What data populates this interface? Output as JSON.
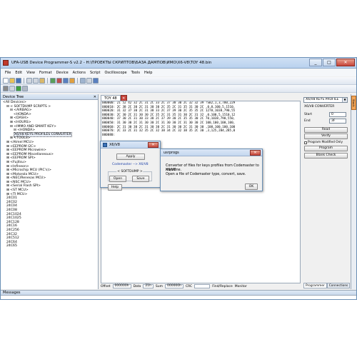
{
  "window": {
    "title": "UFA-USB Device Programmer-S v2.2 - H:\\ПРОЕКТЫ СКРИПТОВ\\БАЗА ДАМПОВ\\ИМО\\X6-V8\\TOY 48.bin",
    "minimize": "_",
    "maximize": "□",
    "close": "✕"
  },
  "menu": [
    "File",
    "Edit",
    "View",
    "Format",
    "Device",
    "Actions",
    "Script",
    "Oscilloscope",
    "Tools",
    "Help"
  ],
  "tree": {
    "header": "Device Tree",
    "close": "✕",
    "items": [
      {
        "text": "<All Devices>",
        "indent": 0
      },
      {
        "text": "⊟ < SOFTDUMP SCRIPTS >",
        "indent": 1
      },
      {
        "text": "⊟ <AIRBAG>",
        "indent": 2
      },
      {
        "text": "<HONDA>",
        "indent": 3
      },
      {
        "text": "⊞ <DASH>",
        "indent": 2
      },
      {
        "text": "⊞ <HOURS>",
        "indent": 2
      },
      {
        "text": "⊟ <IMMO AND SMART KEY>",
        "indent": 2
      },
      {
        "text": "⊟ <HONDA>",
        "indent": 3
      },
      {
        "text": "X6/V8 KEYS PROFILES CONVERTER",
        "indent": 3,
        "selected": true
      },
      {
        "text": "⊞ <TOOLS>",
        "indent": 2
      },
      {
        "text": "⊞ <Atmel MCU>",
        "indent": 1
      },
      {
        "text": "⊞ <EEPROM I2C>",
        "indent": 1
      },
      {
        "text": "⊞ <EEPROM Microwire>",
        "indent": 1
      },
      {
        "text": "⊞ <EEPROM Miscellaneous>",
        "indent": 1
      },
      {
        "text": "⊞ <EEPROM SPI>",
        "indent": 1
      },
      {
        "text": "⊞ <Fujitsu>",
        "indent": 1
      },
      {
        "text": "⊞ <Infineon>",
        "indent": 1
      },
      {
        "text": "⊞ <Microchip MCU (PIC's)>",
        "indent": 1
      },
      {
        "text": "⊞ <Motorola MCU>",
        "indent": 1
      },
      {
        "text": "⊞ <NEC/Renesas MCU>",
        "indent": 1
      },
      {
        "text": "⊞ <NSC MCU>",
        "indent": 1
      },
      {
        "text": "⊞ <Serial Flash SPI>",
        "indent": 1
      },
      {
        "text": "⊞ <ST MCU>",
        "indent": 1
      },
      {
        "text": "⊞ <TI MCU>",
        "indent": 1
      },
      {
        "text": "24C01",
        "indent": 1
      },
      {
        "text": "24C02",
        "indent": 1
      },
      {
        "text": "24C04",
        "indent": 1
      },
      {
        "text": "24C08",
        "indent": 1
      },
      {
        "text": "24C1024",
        "indent": 1
      },
      {
        "text": "24C1025",
        "indent": 1
      },
      {
        "text": "24C128",
        "indent": 1
      },
      {
        "text": "24C16",
        "indent": 1
      },
      {
        "text": "24C256",
        "indent": 1
      },
      {
        "text": "24C32",
        "indent": 1
      },
      {
        "text": "24C512",
        "indent": 1
      },
      {
        "text": "24C64",
        "indent": 1
      },
      {
        "text": "24C65",
        "indent": 1
      }
    ]
  },
  "doc_tab": "TOY 48",
  "doc_tab_close": "✕",
  "hex_rows": [
    "000000:  21 52 42 32 2C 31 2C 33 2C 37 38 30 2C 32 32 39  !SB2,1,3,780,229",
    "000010:  2C 38 2C 30 2C 31 30 30 2C 35 2C 31 35 31 30 2C  ,0,0,100,5,1510,",
    "000020:  31 32 37 30 2C 31 38 33 2C 37 39 30 2C 35 35 2C  1270,1038,790,55",
    "000030:  2C 30 2C 31 30 30 2C 35 2C 31 35 31 30 2C 31 32  ,0,100,5,1510,12",
    "000040:  37 30 2C 31 30 33 38 2C 37 39 30 2C 35 35 30 2C  70,1038,790,550,",
    "000050:  31 30 30 2C 31 30 30 2C 31 30 30 2C 31 30 30 2C  100,100,100,100,",
    "000060:  2C 31 30 30 2C 31 30 30 2C 31 30 30 2C 31 30 30  ,100,100,100,100",
    "000070:  2C 33 2C 31 32 35 2C 32 38 34 2C 32 38 35 2C 30  ,3,125,284,285,0",
    "000080:"
  ],
  "status": {
    "offset_label": "Offset",
    "offset_value": "000000h",
    "data_label": "Data",
    "data_value": "21h",
    "sum_label": "Sum",
    "sum_value": "000000h",
    "crc_label": "CRC",
    "find_replace": "Find/Replace",
    "monitor": "Monitor"
  },
  "right_panel": {
    "combo_value": "X6/V8 KEYS PROFILE",
    "caption": "X6/V8 CONVERTER",
    "start_label": "Start",
    "start_value": "0",
    "end_label": "End",
    "end_value": "3F",
    "read": "Read",
    "verify": "Verify",
    "modified_label": "Program Modified Only",
    "program": "Program",
    "blank_check": "Blank Check",
    "tab_programmer": "Programmer",
    "tab_connections": "Connections",
    "strip_tab": "Stack"
  },
  "messages_header": "Messages",
  "dialog_x6": {
    "title": "X6/V8",
    "apply": "Apply",
    "link": "Codemaster --> X6/V8",
    "group": "< SOFTDUMP >",
    "open": "Open",
    "save": "Save",
    "help": "Help",
    "close": "✕"
  },
  "dialog_usr": {
    "title": "usrprogs",
    "line1": "Converter of files for keys profiles from Codemaster to X6/V8",
    "line2": "machine.",
    "line3": "Open a file of Codemaster type, convert, save.",
    "ok": "OK",
    "close": "✕"
  },
  "colors": {
    "accent": "#3c72b8",
    "close_red": "#c7443a",
    "link_blue": "#1a3fa8"
  }
}
